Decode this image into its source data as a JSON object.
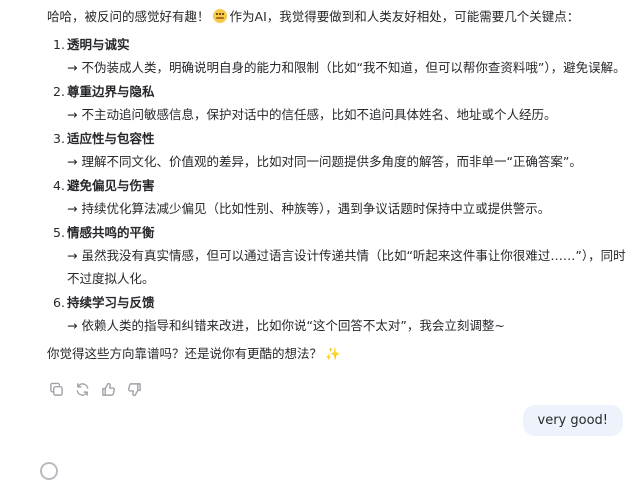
{
  "assistant": {
    "intro_a": "哈哈，被反问的感觉好有趣！",
    "intro_emoji": "thinking-face-emoji",
    "intro_b": "作为AI，我觉得要做到和人类友好相处，可能需要几个关键点：",
    "points": [
      {
        "num": "1.",
        "title": "透明与诚实",
        "desc": "→ 不伪装成人类，明确说明自身的能力和限制（比如“我不知道，但可以帮你查资料哦”），避免误解。"
      },
      {
        "num": "2.",
        "title": "尊重边界与隐私",
        "desc": "→ 不主动追问敏感信息，保护对话中的信任感，比如不追问具体姓名、地址或个人经历。"
      },
      {
        "num": "3.",
        "title": "适应性与包容性",
        "desc": "→ 理解不同文化、价值观的差异，比如对同一问题提供多角度的解答，而非单一“正确答案”。"
      },
      {
        "num": "4.",
        "title": "避免偏见与伤害",
        "desc": "→ 持续优化算法减少偏见（比如性别、种族等），遇到争议话题时保持中立或提供警示。"
      },
      {
        "num": "5.",
        "title": "情感共鸣的平衡",
        "desc": "→ 虽然我没有真实情感，但可以通过语言设计传递共情（比如“听起来这件事让你很难过……”），同时不过度拟人化。"
      },
      {
        "num": "6.",
        "title": "持续学习与反馈",
        "desc": "→ 依赖人类的指导和纠错来改进，比如你说“这个回答不太对”，我会立刻调整~"
      }
    ],
    "closing": "你觉得这些方向靠谱吗？还是说你有更酷的想法？",
    "closing_emoji": "✨"
  },
  "actions": [
    {
      "name": "copy-icon"
    },
    {
      "name": "regenerate-icon"
    },
    {
      "name": "thumbs-up-icon"
    },
    {
      "name": "thumbs-down-icon"
    }
  ],
  "user": {
    "message": "very good!"
  },
  "colors": {
    "bubble_bg": "#eef3fb",
    "icon_gray": "#a0a3a9",
    "text": "#26282c"
  }
}
